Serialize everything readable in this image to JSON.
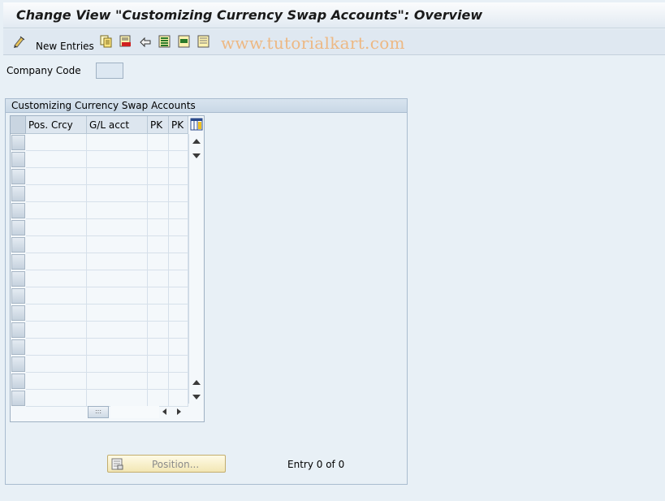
{
  "window": {
    "title": "Change View \"Customizing Currency Swap Accounts\": Overview"
  },
  "toolbar": {
    "items": [
      "edit-icon",
      "new-entries-button",
      "copy-icon",
      "delete-icon",
      "undo-icon",
      "select-all-icon",
      "select-block-icon",
      "deselect-all-icon"
    ],
    "new_entries_label": "New Entries",
    "watermark": "www.tutorialkart.com"
  },
  "form": {
    "company_code_label": "Company Code",
    "company_code_value": ""
  },
  "group": {
    "title": "Customizing Currency Swap Accounts",
    "columns": [
      "Pos. Crcy",
      "G/L acct",
      "PK",
      "PK"
    ],
    "rows": [
      [
        "",
        "",
        "",
        ""
      ],
      [
        "",
        "",
        "",
        ""
      ],
      [
        "",
        "",
        "",
        ""
      ],
      [
        "",
        "",
        "",
        ""
      ],
      [
        "",
        "",
        "",
        ""
      ],
      [
        "",
        "",
        "",
        ""
      ],
      [
        "",
        "",
        "",
        ""
      ],
      [
        "",
        "",
        "",
        ""
      ],
      [
        "",
        "",
        "",
        ""
      ],
      [
        "",
        "",
        "",
        ""
      ],
      [
        "",
        "",
        "",
        ""
      ],
      [
        "",
        "",
        "",
        ""
      ],
      [
        "",
        "",
        "",
        ""
      ],
      [
        "",
        "",
        "",
        ""
      ],
      [
        "",
        "",
        "",
        ""
      ],
      [
        "",
        "",
        "",
        ""
      ]
    ],
    "position_button_label": "Position...",
    "entry_status": "Entry 0 of 0"
  },
  "colors": {
    "background": "#e8f0f6",
    "watermark": "#f0b070",
    "position_button": "#f2e6b4"
  }
}
